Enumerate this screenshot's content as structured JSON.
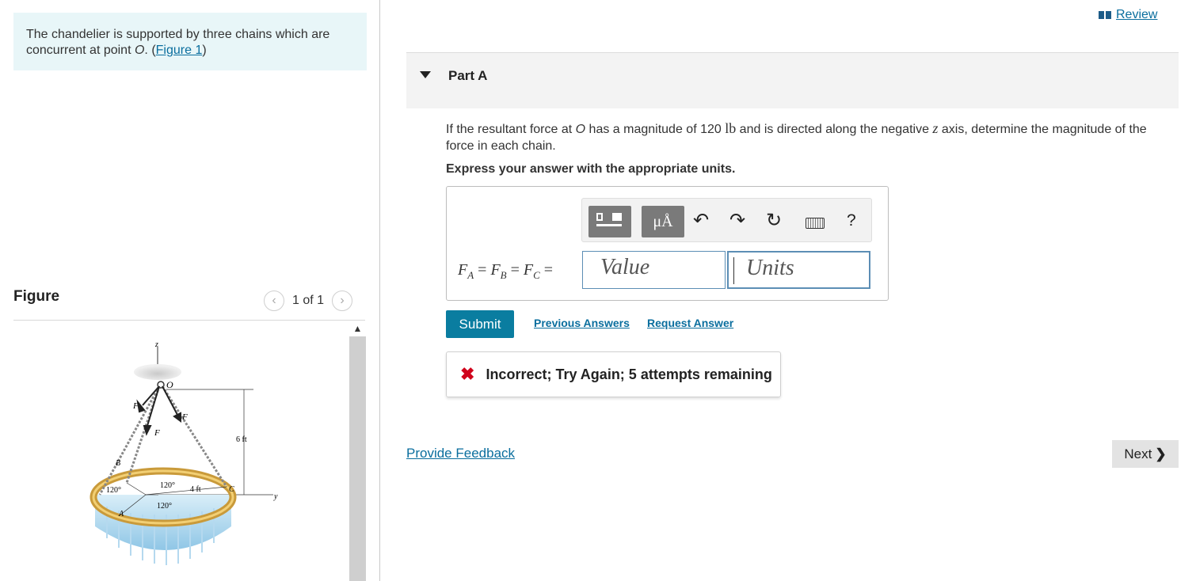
{
  "intro": {
    "text_before": "The chandelier is supported by three chains which are concurrent at point ",
    "point": "O",
    "text_mid": ". (",
    "figure_link": "Figure 1",
    "text_after": ")"
  },
  "figure": {
    "title": "Figure",
    "pager": "1 of 1",
    "diagram_labels": {
      "z": "z",
      "y": "y",
      "O": "O",
      "FB": "F",
      "FC": "F",
      "FA": "F",
      "B": "B",
      "A": "A",
      "C": "C",
      "h": "6 ft",
      "r": "4 ft",
      "a1": "120°",
      "a2": "120°",
      "a3": "120°"
    }
  },
  "review": "Review",
  "part": {
    "title": "Part A"
  },
  "question": {
    "t1": "If the resultant force at ",
    "p": "O",
    "t2": " has a magnitude of 120 ",
    "unit": "lb",
    "t3": " and is directed along the negative ",
    "axis": "z",
    "t4": " axis, determine the magnitude of the force in each chain."
  },
  "instruction": "Express your answer with the appropriate units.",
  "toolbar": {
    "units_tile": "μÅ",
    "undo": "↶",
    "redo": "↷",
    "reset": "↻",
    "help": "?"
  },
  "answer": {
    "value_placeholder": "Value",
    "units_placeholder": "Units"
  },
  "actions": {
    "submit": "Submit",
    "previous_answers": "Previous Answers",
    "request_answer": "Request Answer"
  },
  "feedback": {
    "icon": "✖",
    "message": "Incorrect; Try Again; 5 attempts remaining"
  },
  "footer": {
    "provide_feedback": "Provide Feedback",
    "next": "Next"
  },
  "colors": {
    "accent": "#0a7da0",
    "error": "#d0021b",
    "intro_bg": "#e8f6f8"
  }
}
